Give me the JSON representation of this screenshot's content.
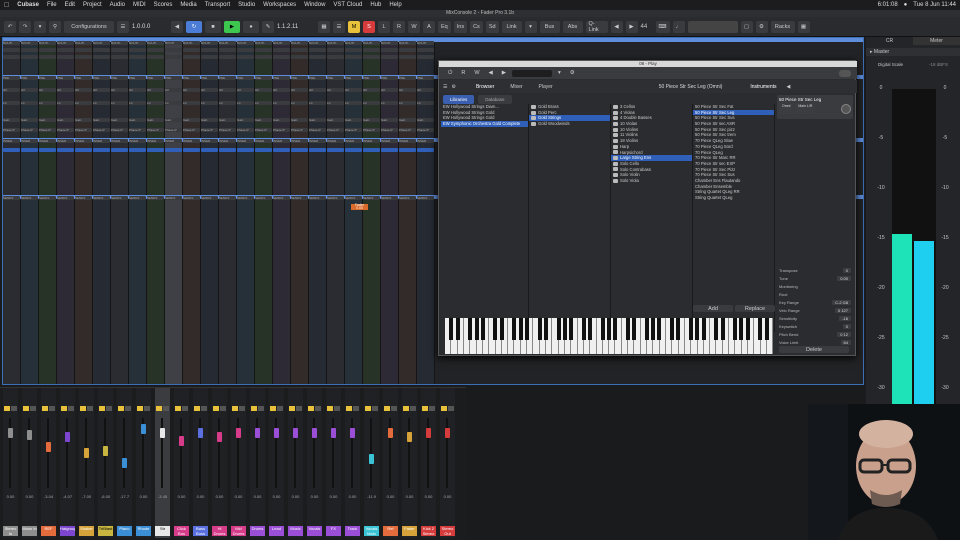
{
  "menubar": {
    "app": "Cubase",
    "items": [
      "File",
      "Edit",
      "Project",
      "Audio",
      "MIDI",
      "Scores",
      "Media",
      "Transport",
      "Studio",
      "Workspaces",
      "Window",
      "VST Cloud",
      "Hub",
      "Help"
    ],
    "clock": "Tue 8 Jun 11:44",
    "cpu": "6:01:08"
  },
  "window_title": "MixConsole 2 - Fader Pro 3.1b",
  "toolbar": {
    "configurations": "Configurations",
    "position": "1.0.0.0",
    "time2": "1.1.2.11",
    "link": "Link",
    "bus": "Bus",
    "abs": "Abs",
    "qlink": "Q-Link",
    "value44": "44",
    "racks": "Racks",
    "m": "M",
    "s": "S",
    "l": "L",
    "r": "R",
    "w": "W",
    "a": "A",
    "eq": "Eq",
    "ins": "Ins",
    "cs": "Cs",
    "sd": "Sd",
    "i": "I"
  },
  "routing": {
    "label": "ROUTI",
    "pre": "PRE",
    "inserts": "INSER",
    "sends": "SENDS"
  },
  "channel_values": {
    "hc": "HC",
    "lc": "LC",
    "db": "20.0H",
    "gain": "Gain",
    "phase": "Phase 0°",
    "fader": "Fader",
    "fader_val": "0.00"
  },
  "plugin": {
    "title": "08 - Play",
    "tabs": [
      "Browser",
      "Mixer",
      "Player"
    ],
    "instrument_name": "50 Piece Str Sec Leg (Omni)",
    "instruments_tab": "Instruments",
    "lib_tabs": [
      "Libraries",
      "Database"
    ],
    "libraries": [
      "EW Hollywood Strings Diam...",
      "EW Hollywood Strings Gold",
      "EW Hollywood Strings Gold",
      "EW Symphonic Orchestra Gold Complete"
    ],
    "col2": [
      "Gold Brass",
      "Gold Perc",
      "Gold Strings",
      "Gold Woodwinds"
    ],
    "col3": [
      "3 Cellos",
      "4 Violas",
      "4 Double Basses",
      "10 Violas",
      "10 Violins",
      "11 Violins",
      "18 Violins",
      "Harp",
      "Harpsichord",
      "Large String Ens",
      "Solo Cello",
      "Solo Contrabass",
      "Solo Violin",
      "Solo Viola"
    ],
    "col4": [
      "50 Piece Str Sec Fat",
      "50 Piece Str Sec Leg",
      "50 Piece Str Sec Sus",
      "50 Piece Str sec ASR",
      "50 Piece Str Sec pizz",
      "50 Piece Str Sec trem",
      "70 Piece QLeg Slow",
      "70 Piece QLeg Sord",
      "70 Piece QLeg",
      "70 Piece Str Marc RR",
      "70 Piece Str sec EXP",
      "70 Piece Str Sec Pizz",
      "70 Piece Str Sec Sus",
      "Chamber Ens Flautando",
      "Chamber Ensemble",
      "String Quartet QLeg RR",
      "String Quartet QLeg"
    ],
    "slot_name": "50 Piece Str Sec Leg",
    "slot_out": "Omni",
    "slot_main": "Main L/R",
    "params": [
      {
        "label": "Transpose",
        "value": "0"
      },
      {
        "label": "Tune",
        "value": "0.00"
      },
      {
        "label": "Monitoring",
        "value": ""
      },
      {
        "label": "Root",
        "value": ""
      },
      {
        "label": "Key Range",
        "value": "C-2  G8"
      },
      {
        "label": "Velo Range",
        "value": "0  127"
      },
      {
        "label": "Sensitivity",
        "value": "-16"
      },
      {
        "label": "Keyswitch",
        "value": "0"
      },
      {
        "label": "Pitch Bend",
        "value": "0  12"
      },
      {
        "label": "Voice Limit",
        "value": "64"
      }
    ],
    "add": "Add",
    "replace": "Replace",
    "delete": "Delete"
  },
  "right_zone": {
    "tabs": [
      "CR",
      "Meter"
    ],
    "master": "Master",
    "scale": "Digital Scale",
    "scale_sub": "-18 dBFS",
    "ticks": [
      "0",
      "-5",
      "-10",
      "-15",
      "-20",
      "-25",
      "-30",
      "-35"
    ],
    "levels": [
      0.54,
      0.52
    ]
  },
  "bottom_channels": [
    {
      "name": "Stereo In",
      "color": "#8e8e8e"
    },
    {
      "name": "Mono In",
      "color": "#8e8e8e"
    },
    {
      "name": "REF",
      "color": "#e36b3c"
    },
    {
      "name": "Hatgroup",
      "color": "#7d46d0"
    },
    {
      "name": "Shaker",
      "color": "#d6a33a"
    },
    {
      "name": "TriBlast",
      "color": "#c8b640"
    },
    {
      "name": "Piano",
      "color": "#3a8fd6"
    },
    {
      "name": "Rhode",
      "color": "#3a8fd6"
    },
    {
      "name": "Str",
      "color": "#e8e8e8"
    },
    {
      "name": "Click Bus",
      "color": "#d63c8a"
    },
    {
      "name": "Bass Buss",
      "color": "#5a6fe0"
    },
    {
      "name": "Hi Drums",
      "color": "#d63c8a"
    },
    {
      "name": "Mid Drums",
      "color": "#d63c8a"
    },
    {
      "name": "Drums",
      "color": "#9b4fd6"
    },
    {
      "name": "Lead",
      "color": "#9b4fd6"
    },
    {
      "name": "Music",
      "color": "#9b4fd6"
    },
    {
      "name": "Vocals",
      "color": "#9b4fd6"
    },
    {
      "name": "FX",
      "color": "#9b4fd6"
    },
    {
      "name": "Track",
      "color": "#9b4fd6"
    },
    {
      "name": "Vocals Main",
      "color": "#3ac4d6"
    },
    {
      "name": "Ref",
      "color": "#e36b3c"
    },
    {
      "name": "Fader",
      "color": "#d6a33a"
    },
    {
      "name": "Kick 2 Stereo",
      "color": "#d63c3c"
    },
    {
      "name": "Stereo Out",
      "color": "#d63c3c"
    }
  ],
  "bottom_values": [
    "0.00",
    "0.00",
    "-3.04",
    "-4.07",
    "-7.00",
    "-6.00",
    "-17.7",
    "0.00",
    "-3.45",
    "0.00",
    "0.00",
    "0.00",
    "0.00",
    "0.00",
    "0.00",
    "0.00",
    "0.00",
    "0.00",
    "0.00",
    "-11.9",
    "0.00",
    "0.00",
    "0.00",
    "0.00"
  ]
}
